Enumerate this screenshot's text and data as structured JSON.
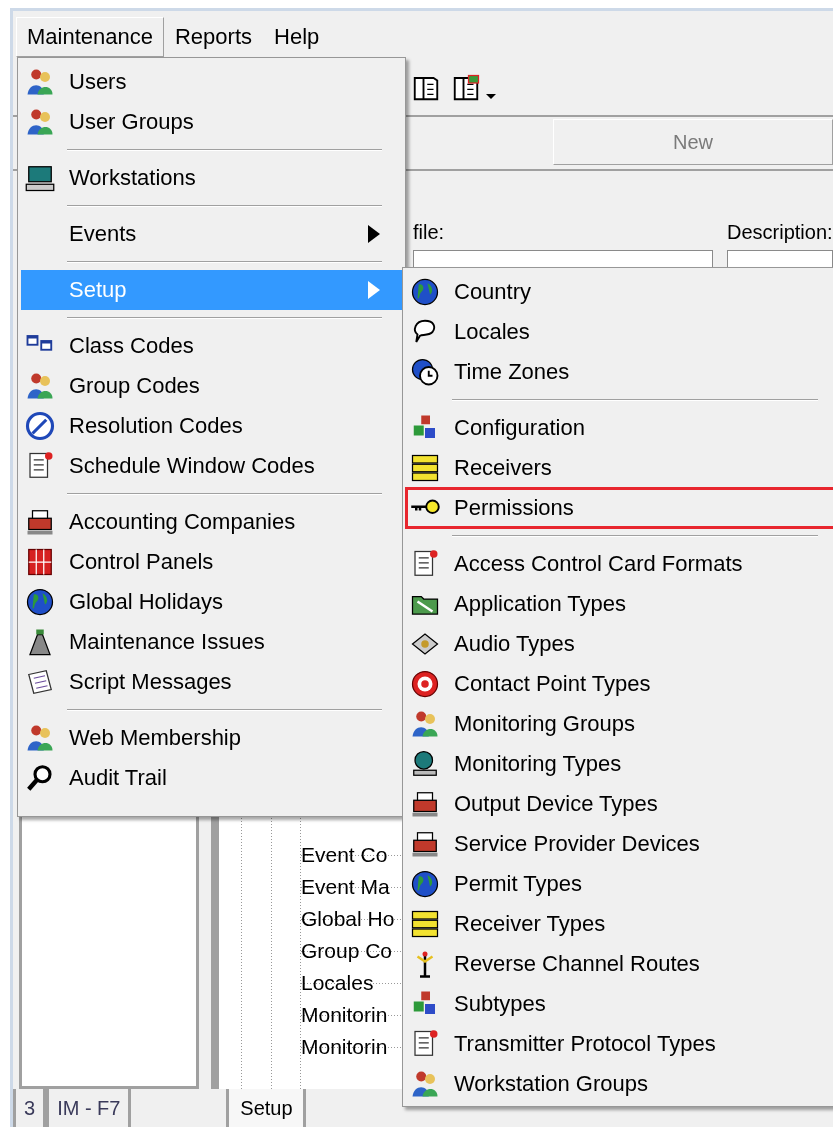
{
  "menu_bar": [
    {
      "label": "Maintenance",
      "selected": true
    },
    {
      "label": "Reports",
      "selected": false
    },
    {
      "label": "Help",
      "selected": false
    }
  ],
  "toolbar": {
    "new_button": {
      "label": "New",
      "disabled": true
    }
  },
  "form": {
    "file_label": "file:",
    "description_label": "Description:"
  },
  "tree": {
    "items": [
      "Event Co",
      "Event Ma",
      "Global Ho",
      "Group Co",
      "Locales",
      "Monitorin",
      "Monitorin"
    ]
  },
  "bottom_tabs": [
    {
      "label": "3",
      "selected": false
    },
    {
      "label": "IM - F7",
      "selected": false
    },
    {
      "label": "Setup",
      "selected": true
    }
  ],
  "maintenance_menu": {
    "items": [
      {
        "kind": "item",
        "label": "Users",
        "selected": false
      },
      {
        "kind": "item",
        "label": "User Groups",
        "selected": false
      },
      {
        "kind": "separator"
      },
      {
        "kind": "item",
        "label": "Workstations",
        "selected": false
      },
      {
        "kind": "separator"
      },
      {
        "kind": "submenu",
        "label": "Events",
        "selected": false
      },
      {
        "kind": "separator"
      },
      {
        "kind": "submenu",
        "label": "Setup",
        "selected": true
      },
      {
        "kind": "separator"
      },
      {
        "kind": "item",
        "label": "Class Codes",
        "selected": false
      },
      {
        "kind": "item",
        "label": "Group Codes",
        "selected": false
      },
      {
        "kind": "item",
        "label": "Resolution Codes",
        "selected": false
      },
      {
        "kind": "item",
        "label": "Schedule Window Codes",
        "selected": false
      },
      {
        "kind": "separator"
      },
      {
        "kind": "item",
        "label": "Accounting Companies",
        "selected": false
      },
      {
        "kind": "item",
        "label": "Control Panels",
        "selected": false
      },
      {
        "kind": "item",
        "label": "Global Holidays",
        "selected": false
      },
      {
        "kind": "item",
        "label": "Maintenance Issues",
        "selected": false
      },
      {
        "kind": "item",
        "label": "Script Messages",
        "selected": false
      },
      {
        "kind": "separator"
      },
      {
        "kind": "item",
        "label": "Web Membership",
        "selected": false
      },
      {
        "kind": "item",
        "label": "Audit Trail",
        "selected": false
      }
    ]
  },
  "setup_submenu": {
    "items": [
      {
        "kind": "item",
        "label": "Country",
        "highlighted": false
      },
      {
        "kind": "item",
        "label": "Locales",
        "highlighted": false
      },
      {
        "kind": "item",
        "label": "Time Zones",
        "highlighted": false
      },
      {
        "kind": "separator"
      },
      {
        "kind": "item",
        "label": "Configuration",
        "highlighted": false
      },
      {
        "kind": "item",
        "label": "Receivers",
        "highlighted": false
      },
      {
        "kind": "item",
        "label": "Permissions",
        "highlighted": true
      },
      {
        "kind": "separator"
      },
      {
        "kind": "item",
        "label": "Access Control Card Formats",
        "highlighted": false
      },
      {
        "kind": "item",
        "label": "Application Types",
        "highlighted": false
      },
      {
        "kind": "item",
        "label": "Audio Types",
        "highlighted": false
      },
      {
        "kind": "item",
        "label": "Contact Point Types",
        "highlighted": false
      },
      {
        "kind": "item",
        "label": "Monitoring Groups",
        "highlighted": false
      },
      {
        "kind": "item",
        "label": "Monitoring Types",
        "highlighted": false
      },
      {
        "kind": "item",
        "label": "Output Device Types",
        "highlighted": false
      },
      {
        "kind": "item",
        "label": "Service Provider Devices",
        "highlighted": false
      },
      {
        "kind": "item",
        "label": "Permit Types",
        "highlighted": false
      },
      {
        "kind": "item",
        "label": "Receiver Types",
        "highlighted": false
      },
      {
        "kind": "item",
        "label": "Reverse Channel Routes",
        "highlighted": false
      },
      {
        "kind": "item",
        "label": "Subtypes",
        "highlighted": false
      },
      {
        "kind": "item",
        "label": "Transmitter Protocol Types",
        "highlighted": false
      },
      {
        "kind": "item",
        "label": "Workstation Groups",
        "highlighted": false
      }
    ]
  }
}
